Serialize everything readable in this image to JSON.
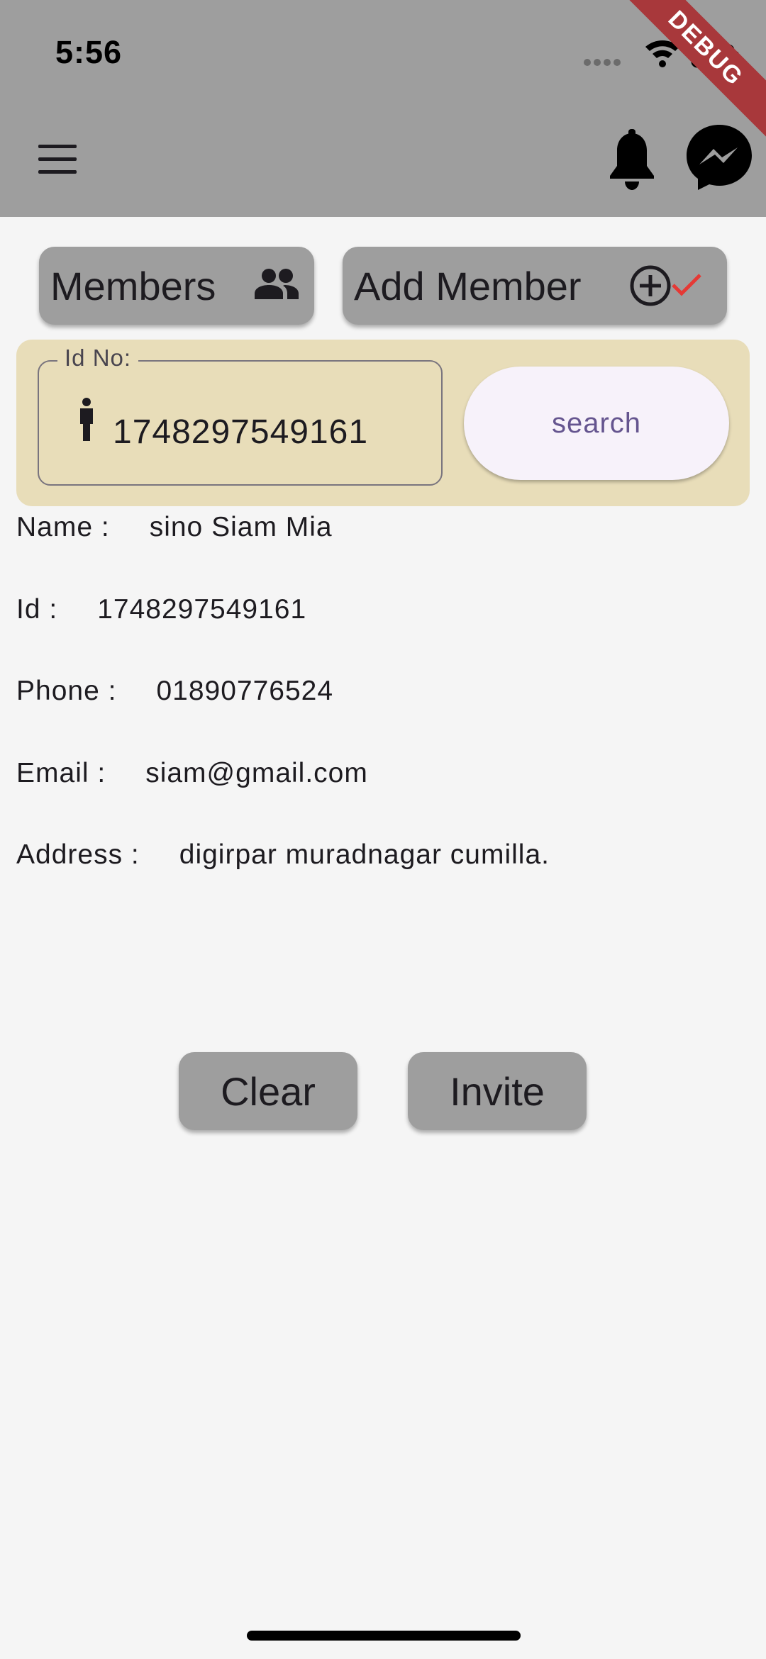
{
  "status_bar": {
    "time": "5:56",
    "debug_label": "DEBUG",
    "icons": [
      "signal-dots-icon",
      "wifi-icon",
      "battery-icon"
    ]
  },
  "app_bar": {
    "icons": [
      "menu-icon",
      "bell-icon",
      "messenger-icon"
    ],
    "background": "#9e9e9e"
  },
  "top_buttons": {
    "members_label": "Members",
    "members_icon": "group-icon",
    "add_member_label": "Add Member",
    "add_member_icons": [
      "add-circle-icon",
      "check-icon"
    ],
    "check_color": "#e53935"
  },
  "search": {
    "field_label": "Id No:",
    "field_icon": "person-icon",
    "field_value": "1748297549161",
    "button_label": "search",
    "panel_color": "#e8ddb9"
  },
  "member": {
    "name_label": "Name :",
    "name_value": "sino Siam Mia",
    "id_label": "Id :",
    "id_value": "1748297549161",
    "phone_label": "Phone :",
    "phone_value": "01890776524",
    "email_label": "Email :",
    "email_value": "siam@gmail.com",
    "address_label": "Address :",
    "address_value": "digirpar muradnagar cumilla."
  },
  "actions": {
    "clear_label": "Clear",
    "invite_label": "Invite"
  }
}
